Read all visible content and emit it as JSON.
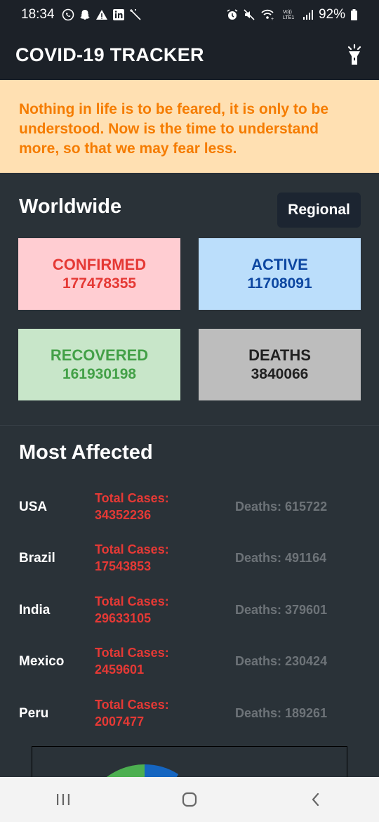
{
  "status_bar": {
    "time": "18:34",
    "battery": "92%",
    "left_icons": [
      "whatsapp-icon",
      "snapchat-icon",
      "alert-icon",
      "linkedin-icon",
      "magic-wand-icon"
    ],
    "right_icons": [
      "alarm-icon",
      "mute-icon",
      "wifi-icon",
      "volte-icon",
      "signal-icon",
      "battery-icon"
    ]
  },
  "app_bar": {
    "title": "COVID-19 TRACKER",
    "action_icon": "flashlight-icon"
  },
  "quote": "Nothing in life is to be feared, it is only to be understood. Now is the time to understand more, so that we may fear less.",
  "worldwide": {
    "title": "Worldwide",
    "regional_button": "Regional",
    "stats": [
      {
        "label": "CONFIRMED",
        "value": "177478355",
        "bg": "#ffcdd2",
        "color": "#e53935"
      },
      {
        "label": "ACTIVE",
        "value": "11708091",
        "bg": "#bbdefb",
        "color": "#0d47a1"
      },
      {
        "label": "RECOVERED",
        "value": "161930198",
        "bg": "#c8e6c9",
        "color": "#43a047"
      },
      {
        "label": "DEATHS",
        "value": "3840066",
        "bg": "#bdbdbd",
        "color": "#212121"
      }
    ]
  },
  "most_affected": {
    "title": "Most Affected",
    "rows": [
      {
        "country": "USA",
        "cases_label": "Total Cases:",
        "cases": "34352236",
        "deaths": "Deaths: 615722"
      },
      {
        "country": "Brazil",
        "cases_label": "Total Cases:",
        "cases": "17543853",
        "deaths": "Deaths: 491164"
      },
      {
        "country": "India",
        "cases_label": "Total Cases:",
        "cases": "29633105",
        "deaths": "Deaths: 379601"
      },
      {
        "country": "Mexico",
        "cases_label": "Total Cases:",
        "cases": "2459601",
        "deaths": "Deaths: 230424"
      },
      {
        "country": "Peru",
        "cases_label": "Total Cases:",
        "cases": "2007477",
        "deaths": "Deaths: 189261"
      }
    ]
  },
  "chart_colors": {
    "green": "#4caf50",
    "blue": "#1565c0"
  },
  "nav_bar": {
    "icons": [
      "recent-apps-icon",
      "home-icon",
      "back-icon"
    ]
  }
}
